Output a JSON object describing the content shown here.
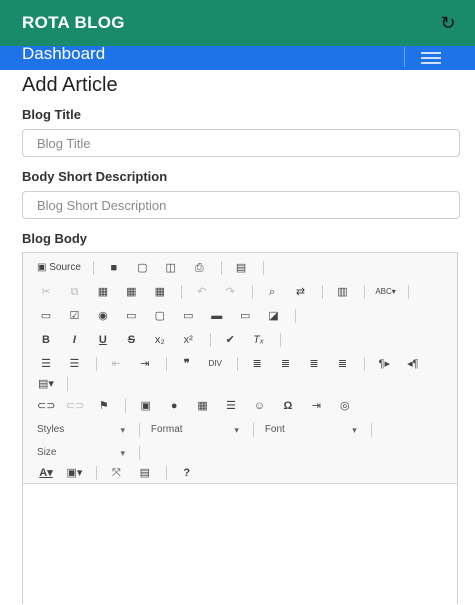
{
  "app": {
    "title": "ROTA BLOG",
    "refresh_icon": "↻"
  },
  "nav": {
    "brand": "Dashboard"
  },
  "page": {
    "heading": "Add Article"
  },
  "form": {
    "title_label": "Blog Title",
    "title_placeholder": "Blog Title",
    "short_label": "Body Short Description",
    "short_placeholder": "Blog Short Description",
    "body_label": "Blog Body"
  },
  "editor": {
    "source_label": "Source",
    "spell_label": "ABC",
    "combos": {
      "styles": "Styles",
      "format": "Format",
      "font": "Font",
      "size": "Size"
    },
    "help_label": "?"
  },
  "colors": {
    "appbar": "#1a8a6d",
    "navbar": "#1e73e8"
  }
}
